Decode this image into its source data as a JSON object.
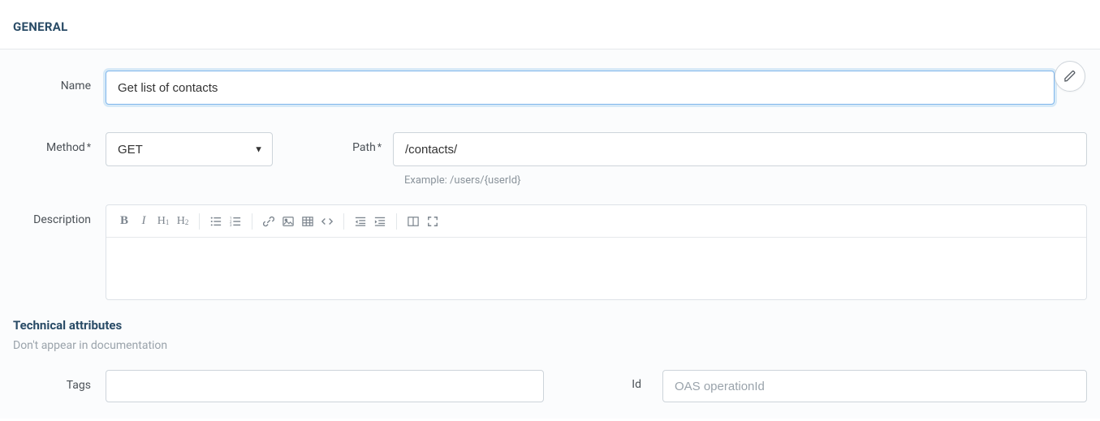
{
  "header": {
    "title": "GENERAL"
  },
  "form": {
    "name": {
      "label": "Name",
      "value": "Get list of contacts"
    },
    "method": {
      "label": "Method",
      "selected": "GET"
    },
    "path": {
      "label": "Path",
      "value": "/contacts/",
      "hint": "Example: /users/{userId}"
    },
    "description": {
      "label": "Description",
      "value": ""
    }
  },
  "toolbar": {
    "bold": "B",
    "italic": "I",
    "h1": "H",
    "h1_sub": "1",
    "h2": "H",
    "h2_sub": "2"
  },
  "technical": {
    "title": "Technical attributes",
    "subtitle": "Don't appear in documentation",
    "tags": {
      "label": "Tags",
      "value": ""
    },
    "id": {
      "label": "Id",
      "placeholder": "OAS operationId",
      "value": ""
    }
  }
}
